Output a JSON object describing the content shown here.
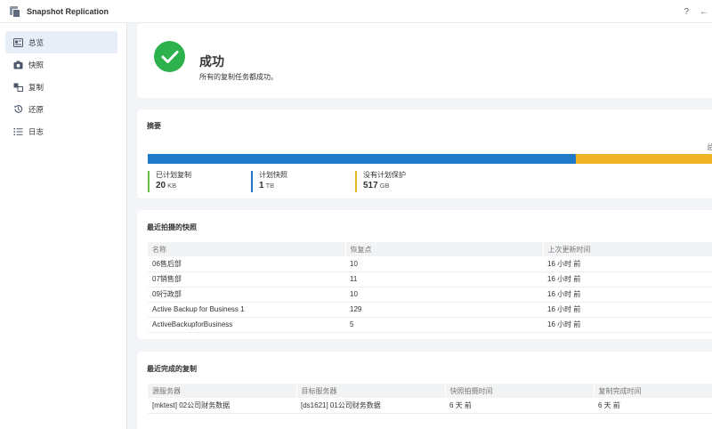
{
  "app": {
    "title": "Snapshot Replication",
    "help_label": "?",
    "back_label": "←"
  },
  "sidebar": {
    "items": [
      {
        "label": "总览",
        "icon": "overview-icon"
      },
      {
        "label": "快照",
        "icon": "camera-icon"
      },
      {
        "label": "复制",
        "icon": "replication-icon"
      },
      {
        "label": "还原",
        "icon": "restore-icon"
      },
      {
        "label": "日志",
        "icon": "log-list-icon"
      }
    ]
  },
  "status": {
    "title": "成功",
    "subtitle": "所有的复制任务都成功。",
    "color": "#2cb14c"
  },
  "summary": {
    "title": "摘要",
    "total_label": "总",
    "bar": {
      "protected_fraction": 0.743,
      "colors": {
        "protected": "#1f78c8",
        "unprotected": "#f0b326"
      }
    },
    "legend": [
      {
        "label": "已计划复制",
        "value": "20",
        "unit": "KB",
        "color": "#6cbf4a"
      },
      {
        "label": "计划快照",
        "value": "1",
        "unit": "TB",
        "color": "#1f78c8"
      },
      {
        "label": "没有计划保护",
        "value": "517",
        "unit": "GB",
        "color": "#f0b326"
      }
    ]
  },
  "snapshots": {
    "title": "最近拍摄的快照",
    "columns": [
      "名称",
      "恢复点",
      "上次更新时间"
    ],
    "rows": [
      [
        "06售后部",
        "10",
        "16 小时 前"
      ],
      [
        "07销售部",
        "11",
        "16 小时 前"
      ],
      [
        "09行政部",
        "10",
        "16 小时 前"
      ],
      [
        "Active Backup for Business 1",
        "129",
        "16 小时 前"
      ],
      [
        "ActiveBackupforBusiness",
        "5",
        "16 小时 前"
      ]
    ]
  },
  "replications": {
    "title": "最近完成的复制",
    "columns": [
      "源服务器",
      "目标服务器",
      "快照拍摄时间",
      "复制完成时间"
    ],
    "rows": [
      [
        "[mktest] 02公司财务数据",
        "[ds1621] 01公司财务数据",
        "6 天 前",
        "6 天 前"
      ]
    ]
  }
}
